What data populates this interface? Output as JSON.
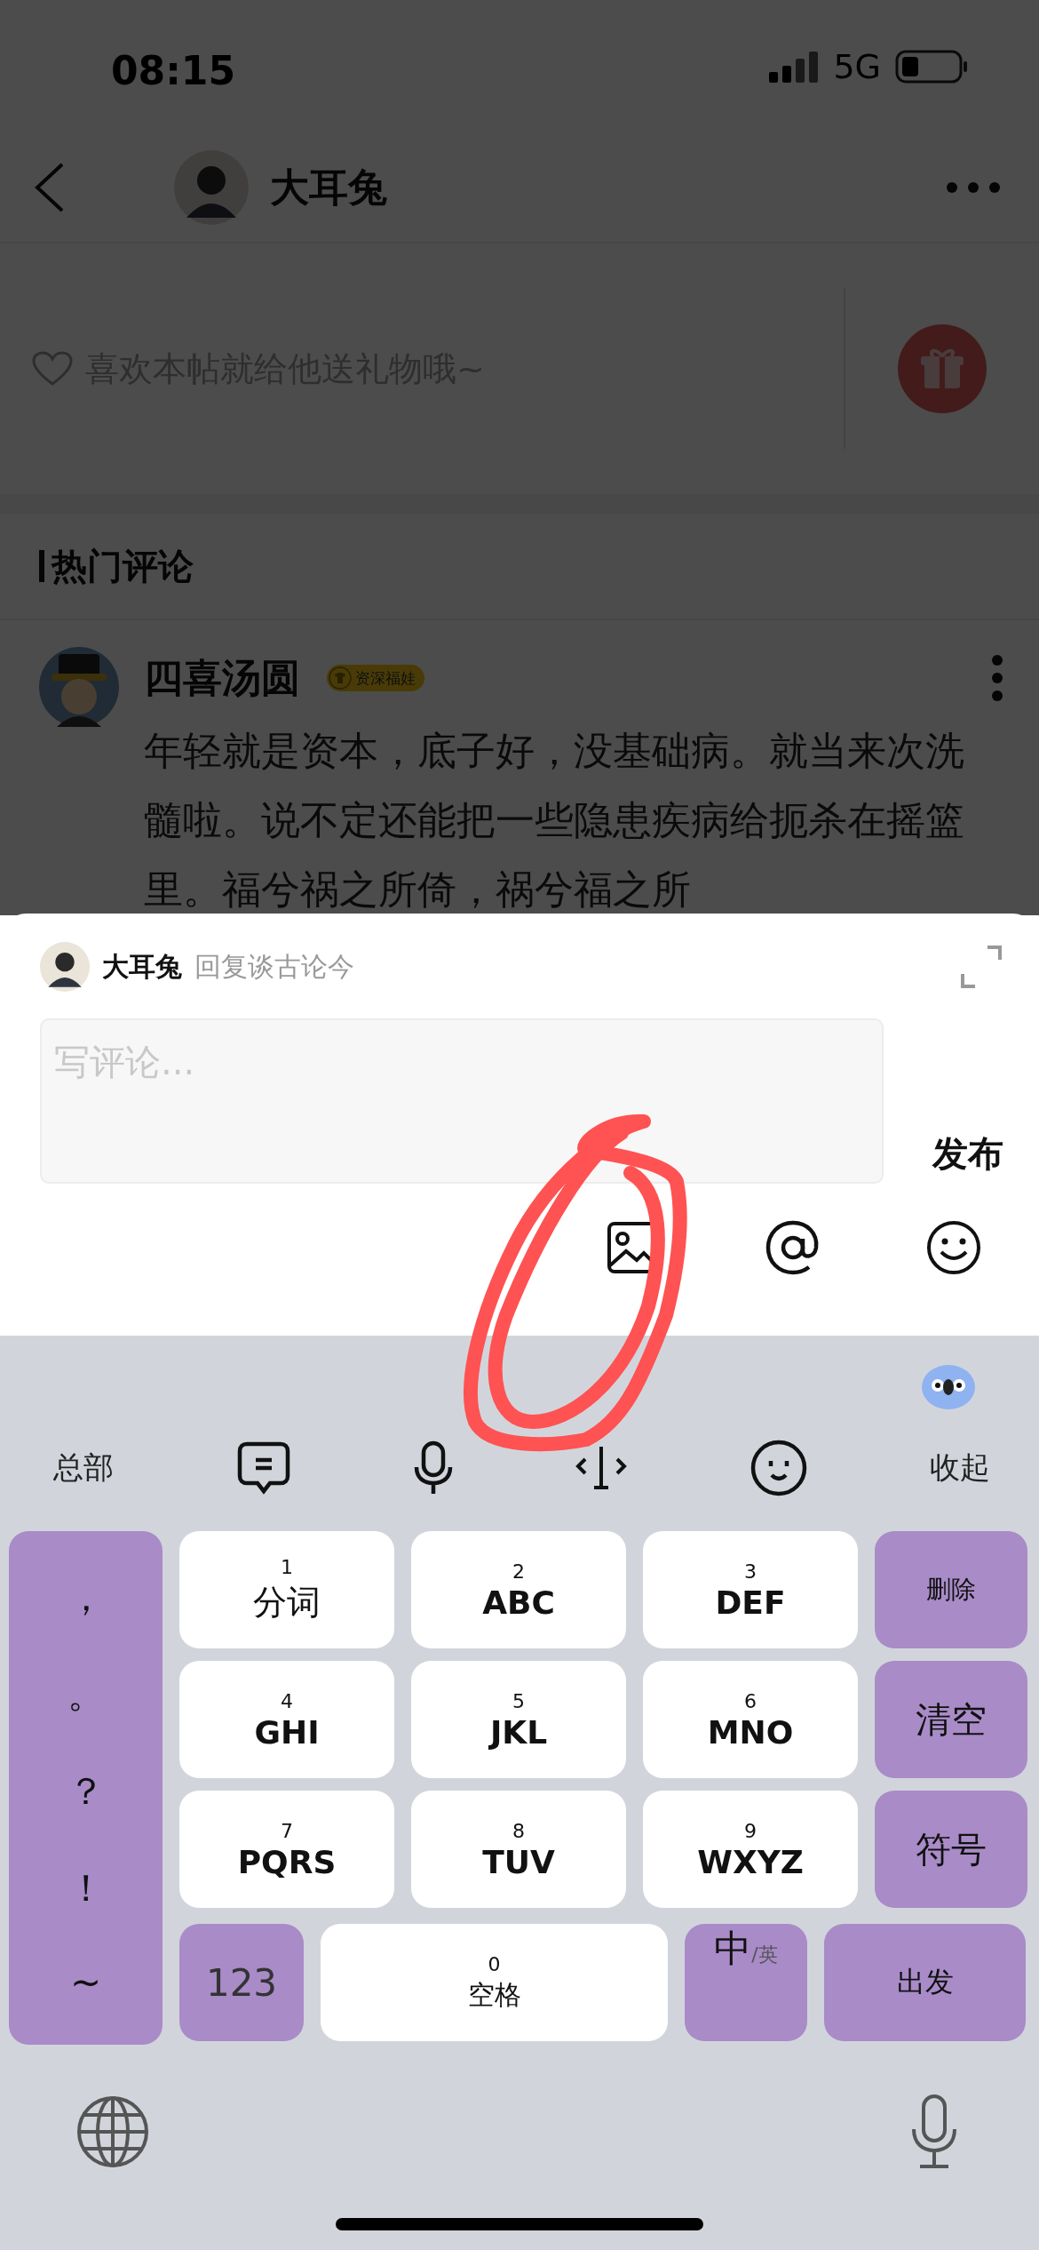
{
  "status_bar": {
    "time": "08:15",
    "network": "5G"
  },
  "header": {
    "title": "大耳兔"
  },
  "gift_bar": {
    "prompt": "喜欢本帖就给他送礼物哦~"
  },
  "section": {
    "title": "热门评论"
  },
  "comment": {
    "author": "四喜汤圆",
    "badge": "资深福娃",
    "text": "年轻就是资本，底子好，没基础病。就当来次洗髓啦。说不定还能把一些隐患疾病给扼杀在摇篮里。福兮祸之所倚，祸兮福之所"
  },
  "reply_sheet": {
    "author": "大耳兔",
    "reply_to": "回复谈古论今",
    "placeholder": "写评论...",
    "submit": "发布"
  },
  "keyboard": {
    "toolbar_left": "总部",
    "toolbar_right": "收起",
    "punctuation": [
      "，",
      "。",
      "？",
      "！",
      "~"
    ],
    "keys": [
      {
        "digit": "1",
        "label": "分词"
      },
      {
        "digit": "2",
        "label": "ABC"
      },
      {
        "digit": "3",
        "label": "DEF"
      },
      {
        "digit": "4",
        "label": "GHI"
      },
      {
        "digit": "5",
        "label": "JKL"
      },
      {
        "digit": "6",
        "label": "MNO"
      },
      {
        "digit": "7",
        "label": "PQRS"
      },
      {
        "digit": "8",
        "label": "TUV"
      },
      {
        "digit": "9",
        "label": "WXYZ"
      }
    ],
    "side_keys": [
      "删除",
      "清空",
      "符号"
    ],
    "numbers": "123",
    "space": {
      "digit": "0",
      "label": "空格"
    },
    "lang": {
      "main": "中",
      "alt": "/英"
    },
    "enter": "出发"
  }
}
